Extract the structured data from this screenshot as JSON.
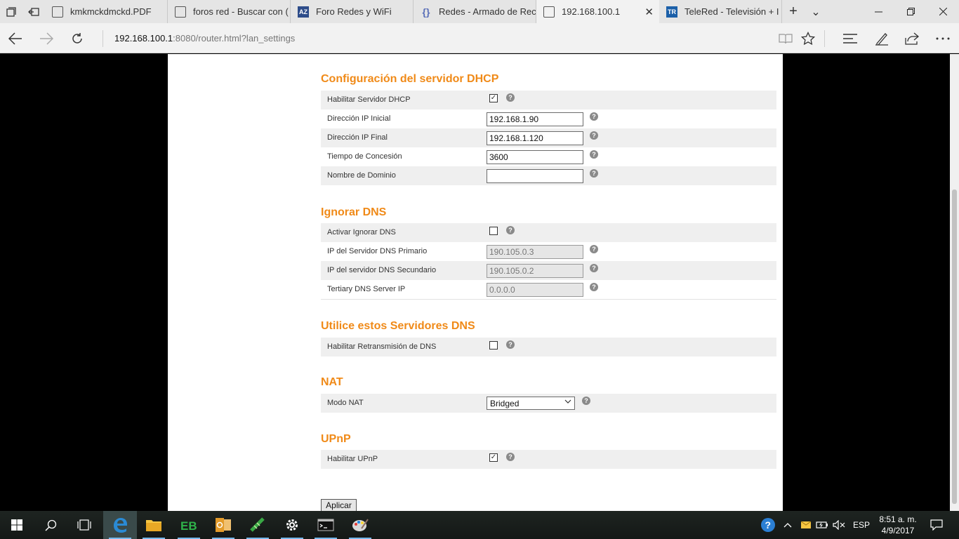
{
  "browser": {
    "tabs": [
      {
        "title": "kmkmckdmckd.PDF",
        "icon": "pdf-doc-icon"
      },
      {
        "title": "foros red - Buscar con (",
        "icon": "search-doc-icon"
      },
      {
        "title": "Foro Redes y WiFi",
        "icon": "az-icon"
      },
      {
        "title": "Redes - Armado de Rec",
        "icon": "brace-icon"
      },
      {
        "title": "192.168.100.1",
        "icon": "doc-icon",
        "active": true
      },
      {
        "title": "TeleRed - Televisión + I",
        "icon": "tr-icon"
      }
    ],
    "tab_close_glyph": "✕",
    "new_tab_glyph": "+",
    "tab_list_glyph": "⌄",
    "favicon_az": "AZ",
    "favicon_tr": "TR",
    "favicon_brace": "{}",
    "url_host": "192.168.100.1",
    "url_rest": ":8080/router.html?lan_settings"
  },
  "dhcp": {
    "title": "Configuración del servidor DHCP",
    "enable_label": "Habilitar Servidor DHCP",
    "enable_checked": true,
    "start_ip_label": "Dirección IP Inicial",
    "start_ip_value": "192.168.1.90",
    "end_ip_label": "Dirección IP Final",
    "end_ip_value": "192.168.1.120",
    "lease_label": "Tiempo de Concesión",
    "lease_value": "3600",
    "domain_label": "Nombre de Dominio",
    "domain_value": ""
  },
  "dns_override": {
    "title": "Ignorar DNS",
    "enable_label": "Activar Ignorar DNS",
    "enable_checked": false,
    "primary_label": "IP del Servidor DNS Primario",
    "primary_value": "190.105.0.3",
    "secondary_label": "IP del servidor DNS Secundario",
    "secondary_value": "190.105.0.2",
    "tertiary_label": "Tertiary DNS Server IP",
    "tertiary_value": "0.0.0.0"
  },
  "dns_relay": {
    "title": "Utilice estos Servidores DNS",
    "enable_label": "Habilitar Retransmisión de DNS",
    "enable_checked": false
  },
  "nat": {
    "title": "NAT",
    "mode_label": "Modo NAT",
    "mode_value": "Bridged"
  },
  "upnp": {
    "title": "UPnP",
    "enable_label": "Habilitar UPnP",
    "enable_checked": true
  },
  "apply_label": "Aplicar",
  "help_glyph": "?",
  "check_glyph": "✓",
  "taskbar": {
    "language": "ESP",
    "time": "8:51 a. m.",
    "date": "4/9/2017"
  },
  "colors": {
    "section_title": "#f08a18",
    "row_shade": "#efefef"
  }
}
